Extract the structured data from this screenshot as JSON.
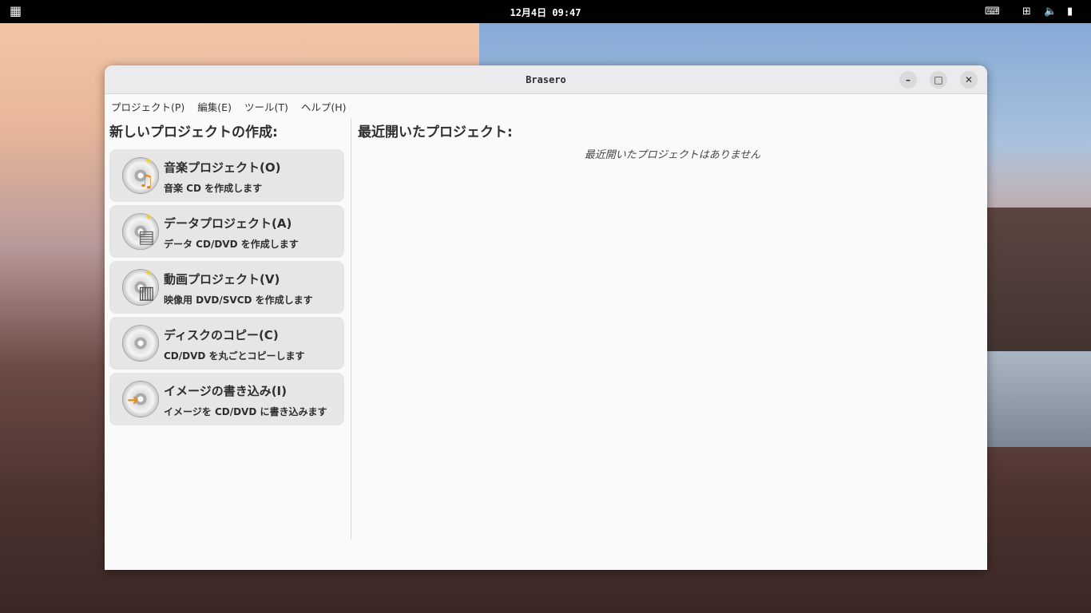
{
  "topbar": {
    "clock": "12月4日 09:47"
  },
  "window": {
    "title": "Brasero"
  },
  "menu": [
    "プロジェクト(P)",
    "編集(E)",
    "ツール(T)",
    "ヘルプ(H)"
  ],
  "left": {
    "heading": "新しいプロジェクトの作成:",
    "projects": [
      {
        "title": "音楽プロジェクト(O)",
        "desc": "音楽 CD を作成します",
        "icon": "audio-disc-icon"
      },
      {
        "title": "データプロジェクト(A)",
        "desc": "データ CD/DVD を作成します",
        "icon": "data-disc-icon"
      },
      {
        "title": "動画プロジェクト(V)",
        "desc": "映像用 DVD/SVCD を作成します",
        "icon": "video-disc-icon"
      },
      {
        "title": "ディスクのコピー(C)",
        "desc": "CD/DVD を丸ごとコピーします",
        "icon": "disc-copy-icon"
      },
      {
        "title": "イメージの書き込み(I)",
        "desc": "イメージを CD/DVD に書き込みます",
        "icon": "image-burn-icon"
      }
    ]
  },
  "right": {
    "heading": "最近開いたプロジェクト:",
    "empty": "最近開いたプロジェクトはありません"
  }
}
